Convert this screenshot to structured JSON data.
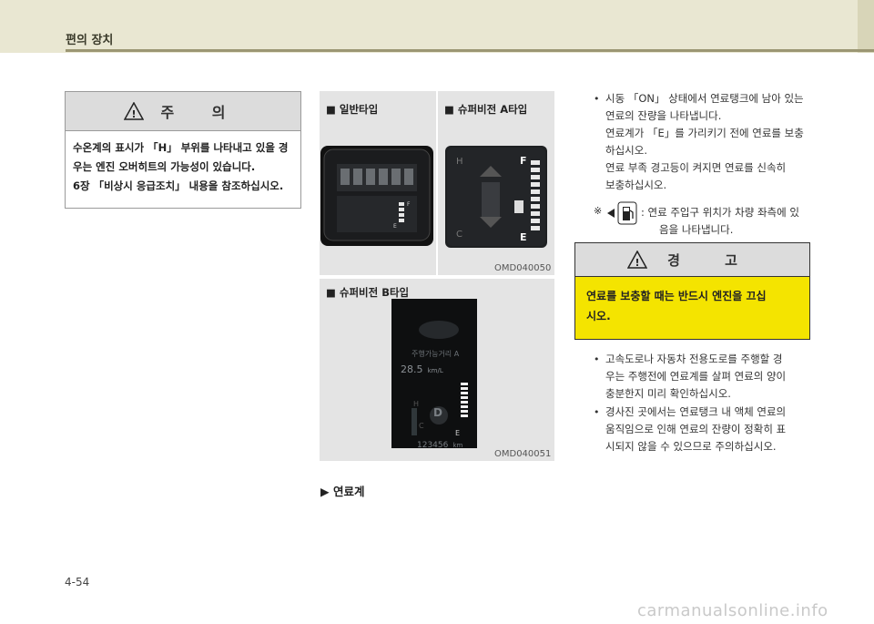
{
  "header": {
    "title": "편의 장치"
  },
  "caution": {
    "title": "주 의",
    "lines": [
      "수온계의 표시가 「H」 부위를 나타내고 있을 경",
      "우는 엔진 오버히트의 가능성이 있습니다.",
      "6장 「비상시 응급조치」 내용을 참조하십시오."
    ]
  },
  "panels": {
    "general": {
      "label": "■  일반타입"
    },
    "super_a": {
      "label": "■  슈퍼비전 A타입"
    },
    "code1": "OMD040050",
    "super_b": {
      "label": "■  슈퍼비전 B타입"
    },
    "code2": "OMD040051",
    "gauge_b_text": {
      "top": "주행가능거리 A",
      "value": "28.5",
      "unit": "km/L",
      "odo": "123456",
      "odo_unit": "km",
      "gear": "D"
    }
  },
  "section_label": "▶ 연료계",
  "right": {
    "p1": [
      "시동 「ON」 상태에서 연료탱크에 남아 있는",
      "연료의 잔량을 나타냅니다.",
      "연료계가 「E」를 가리키기 전에 연료를 보충",
      "하십시오.",
      "연료 부족 경고등이 켜지면 연료를 신속히",
      "보충하십시오."
    ],
    "note_mark": "※",
    "note": [
      ": 연료 주입구 위치가 차량 좌측에 있",
      "음을 나타냅니다."
    ],
    "warning": {
      "title": "경 고",
      "lines": [
        "연료를 보충할 때는 반드시 엔진을 끄십",
        "시오."
      ]
    },
    "p2": [
      "고속도로나 자동차 전용도로를 주행할 경",
      "우는 주행전에 연료계를 살펴 연료의 양이",
      "충분한지 미리 확인하십시오."
    ],
    "p3": [
      "경사진 곳에서는 연료탱크 내 액체 연료의",
      "움직임으로 인해 연료의 잔량이 정확히 표",
      "시되지 않을 수 있으므로 주의하십시오."
    ]
  },
  "page_number": "4-54",
  "watermark": "carmanualsonline.info"
}
